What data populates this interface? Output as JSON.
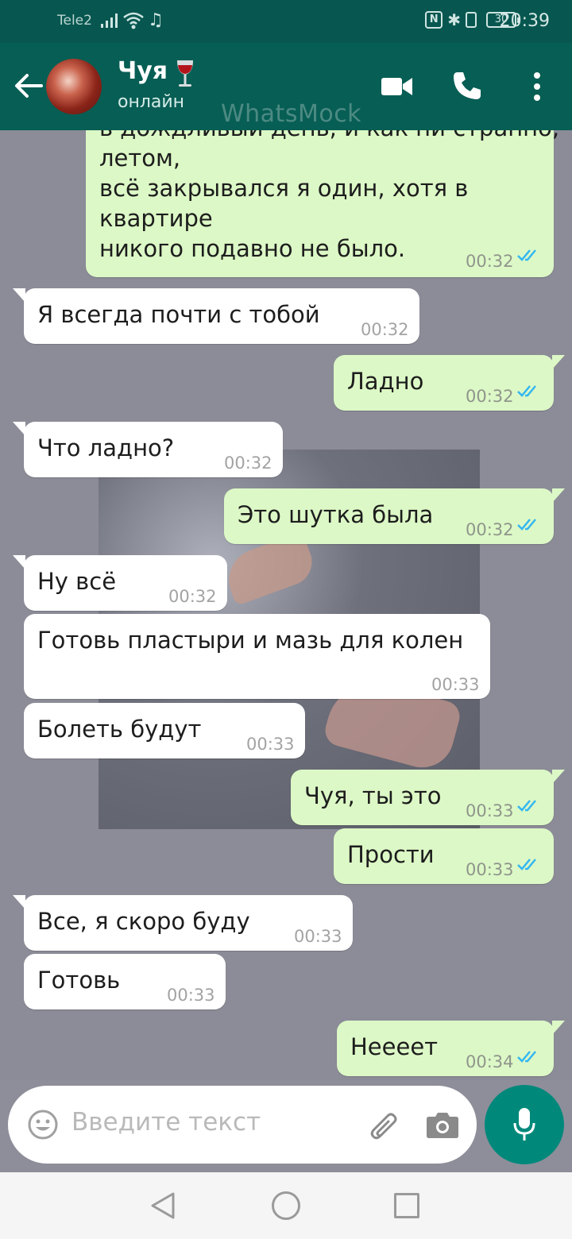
{
  "status_bar": {
    "carrier": "Tele2",
    "battery": "30",
    "time": "20:39"
  },
  "header": {
    "contact_name": "Чуя",
    "presence": "онлайн",
    "watermark": "WhatsMock",
    "icons": [
      "back-arrow-icon",
      "avatar",
      "wine-glass-emoji",
      "video-call-icon",
      "phone-call-icon",
      "more-options-icon"
    ]
  },
  "messages": [
    {
      "dir": "out",
      "lines": [
        "в дождливый день, и как ни странно,",
        "летом,",
        "всё закрывался я один, хотя в",
        "квартире",
        "никого подавно не было."
      ],
      "time": "00:32",
      "read": true
    },
    {
      "dir": "in",
      "text": "Я всегда почти с тобой",
      "time": "00:32"
    },
    {
      "dir": "out",
      "text": "Ладно",
      "time": "00:32",
      "read": true
    },
    {
      "dir": "in",
      "text": "Что ладно?",
      "time": "00:32"
    },
    {
      "dir": "out",
      "text": "Это шутка была",
      "time": "00:32",
      "read": true
    },
    {
      "dir": "in",
      "text": "Ну всё",
      "time": "00:32"
    },
    {
      "dir": "in",
      "text": "Готовь пластыри и мазь для колен",
      "time": "00:33"
    },
    {
      "dir": "in",
      "text": "Болеть будут",
      "time": "00:33"
    },
    {
      "dir": "out",
      "text": "Чуя, ты это",
      "time": "00:33",
      "read": true
    },
    {
      "dir": "out",
      "text": "Прости",
      "time": "00:33",
      "read": true
    },
    {
      "dir": "in",
      "text": "Все, я скоро буду",
      "time": "00:33"
    },
    {
      "dir": "in",
      "text": "Готовь",
      "time": "00:33"
    },
    {
      "dir": "out",
      "text": "Неееет",
      "time": "00:34",
      "read": true
    }
  ],
  "composer": {
    "placeholder": "Введите текст",
    "icons": [
      "emoji-icon",
      "attach-icon",
      "camera-icon",
      "mic-icon"
    ]
  },
  "colors": {
    "header": "#075e54",
    "status_bar": "#075750",
    "outgoing_bubble": "#dcf8c6",
    "incoming_bubble": "#ffffff",
    "read_ticks": "#34b7f1",
    "mic_button": "#00897b",
    "chat_background": "#8c8c98"
  }
}
